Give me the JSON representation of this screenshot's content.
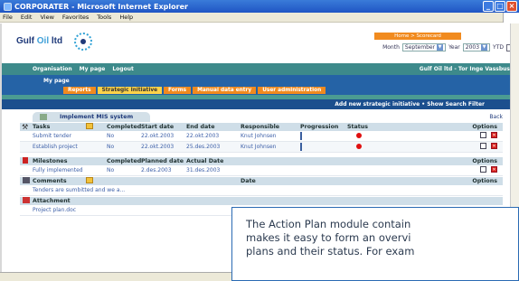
{
  "window": {
    "title": "CORPORATER - Microsoft Internet Explorer"
  },
  "menu": [
    "File",
    "Edit",
    "View",
    "Favorites",
    "Tools",
    "Help"
  ],
  "header": {
    "logo_text_1": "Gulf ",
    "logo_text_2": "Oil",
    "logo_text_3": " ltd",
    "breadcrumb": "Home > Scorecard",
    "month_label": "Month",
    "month_value": "September",
    "year_label": "Year",
    "year_value": "2003",
    "ytd_label": "YTD"
  },
  "nav": {
    "links": [
      "Organisation",
      "My page",
      "Logout"
    ],
    "user": "Gulf Oil ltd - Tor Inge Vassbus",
    "mypage_label": "My page",
    "tabs": [
      "Reports",
      "Strategic Initiative",
      "Forms",
      "Manual data entry",
      "User administration"
    ]
  },
  "actions": {
    "label": "Add new strategic initiative  • Show Search Filter"
  },
  "section": {
    "title": "Implement MIS system",
    "back": "Back"
  },
  "tasks": {
    "headers": [
      "Tasks",
      "Completed",
      "Start date",
      "End date",
      "Responsible",
      "Progression",
      "Status",
      "Options"
    ],
    "rows": [
      {
        "name": "Submit tender",
        "completed": "No",
        "start": "22.okt.2003",
        "end": "22.okt.2003",
        "responsible": "Knut Johnsen",
        "progress": 0.15
      },
      {
        "name": "Establish project",
        "completed": "No",
        "start": "22.okt.2003",
        "end": "25.des.2003",
        "responsible": "Knut Johnsen",
        "progress": 0.1
      }
    ]
  },
  "milestones": {
    "headers": [
      "Milestones",
      "Completed",
      "Planned date",
      "Actual Date",
      "Options"
    ],
    "rows": [
      {
        "name": "Fully implemented",
        "completed": "No",
        "planned": "2.des.2003",
        "actual": "31.des.2003"
      }
    ]
  },
  "comments": {
    "headers": [
      "Comments",
      "Date",
      "Options"
    ],
    "rows": [
      {
        "text": "Tenders are sumbitted and we a..."
      }
    ]
  },
  "attachment": {
    "header": "Attachment",
    "rows": [
      {
        "name": "Project plan.doc"
      }
    ]
  },
  "callout": {
    "line1": "The Action Plan module contain",
    "line2": "makes it easy to form an overvi",
    "line3": "plans and their status. For exam"
  }
}
